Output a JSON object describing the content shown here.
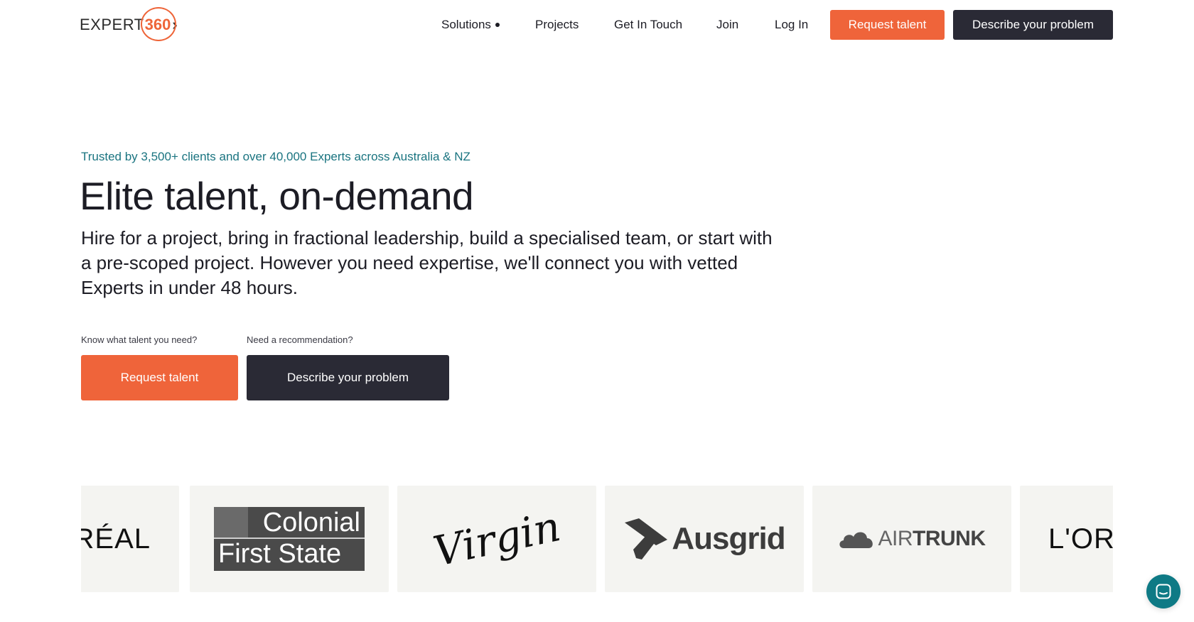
{
  "brand": {
    "logo_text": "EXPERT",
    "logo_number": "360",
    "logo_chevron": "›",
    "accent_color": "#ef643a",
    "dark_color": "#2a2a35",
    "teal_color": "#1a7480"
  },
  "nav": {
    "items": [
      {
        "label": "Solutions",
        "has_dropdown": true
      },
      {
        "label": "Projects"
      },
      {
        "label": "Get In Touch"
      },
      {
        "label": "Join"
      },
      {
        "label": "Log In"
      }
    ],
    "request_talent": "Request talent",
    "describe_problem": "Describe your problem"
  },
  "hero": {
    "trusted": "Trusted by 3,500+ clients and over 40,000 Experts across Australia & NZ",
    "title": "Elite talent, on-demand",
    "description": "Hire for a project, bring in fractional leadership, build a specialised team, or start with a pre-scoped project. However you need expertise, we'll connect you with vetted Experts in under 48 hours.",
    "cta": {
      "left_label": "Know what talent you need?",
      "left_button": "Request talent",
      "right_label": "Need a recommendation?",
      "right_button": "Describe your problem"
    }
  },
  "client_logos": {
    "items": [
      {
        "name": "L'ORÉAL",
        "visible_text": "RÉAL"
      },
      {
        "name": "Colonial First State",
        "line1": "Colonial",
        "line2": "First State"
      },
      {
        "name": "Virgin",
        "visible_text": "Virgin"
      },
      {
        "name": "Ausgrid",
        "visible_text": "Ausgrid"
      },
      {
        "name": "AirTrunk",
        "air": "AIR",
        "trunk": "TRUNK"
      },
      {
        "name": "L'ORÉAL",
        "visible_text": "L'OR"
      }
    ]
  },
  "chat_widget": {
    "icon": "chat-bubble-icon"
  }
}
